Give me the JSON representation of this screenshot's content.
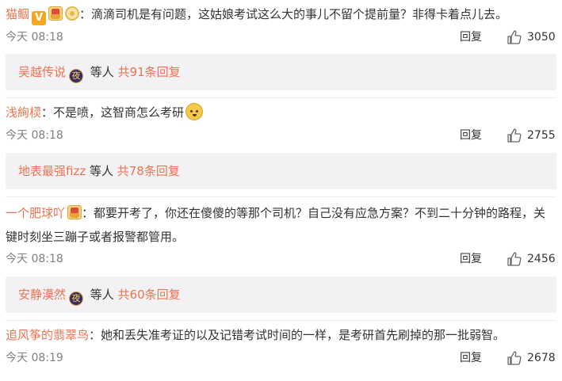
{
  "comments": [
    {
      "username": "猫鲴",
      "text": "：滴滴司机是有问题，这姑娘考试这么大的事儿不留个提前量？非得卡着点儿去。",
      "time": "今天 08:18",
      "reply_label": "回复",
      "likes": "3050",
      "sub": {
        "names": "吴越传说",
        "icon": "夜",
        "suffix": " 等人 ",
        "total": "共91条回复"
      }
    },
    {
      "username": "浅絢棂",
      "text": "：不是喷，这智商怎么考研",
      "time": "今天 08:18",
      "reply_label": "回复",
      "likes": "2755",
      "sub": {
        "names": "地表最强fizz",
        "suffix": " 等人 ",
        "total": "共78条回复"
      }
    },
    {
      "username": "一个肥球吖",
      "text": "：都要开考了，你还在傻傻的等那个司机？自己没有应急方案？不到二十分钟的路程，关键时刻坐三蹦子或者报警都管用。",
      "time": "今天 08:18",
      "reply_label": "回复",
      "likes": "2456",
      "sub": {
        "names": "安静漠然",
        "icon": "夜",
        "suffix": " 等人 ",
        "total": "共60条回复"
      }
    },
    {
      "username": "追风筝的翡翠鸟",
      "text": "：她和丢失准考证的以及记错考试时间的一样，是考研首先刷掉的那一批弱智。",
      "time": "今天 08:19",
      "reply_label": "回复",
      "likes": "2678"
    }
  ],
  "icons": {
    "verified": "V",
    "like": "thumbs-up-icon"
  }
}
